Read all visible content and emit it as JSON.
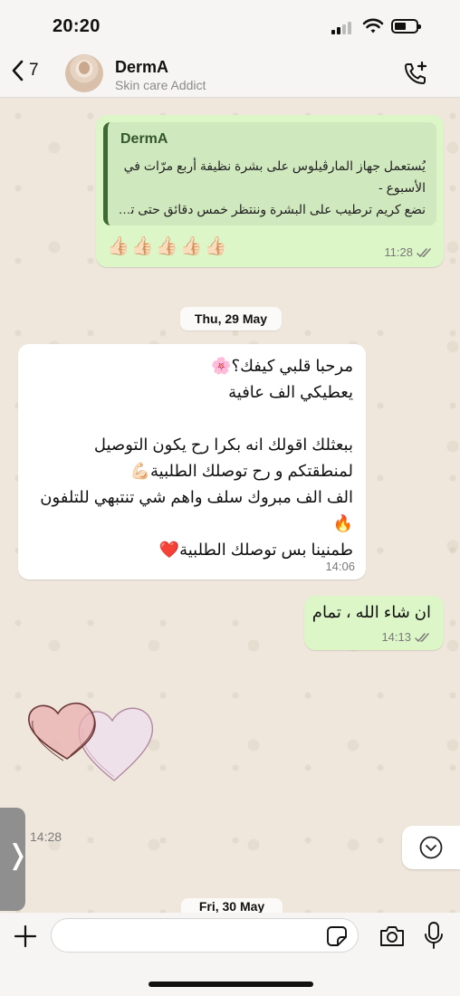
{
  "status_bar": {
    "time": "20:20"
  },
  "header": {
    "back_count": "7",
    "contact_name": "DermA",
    "contact_status": "Skin care Addict"
  },
  "messages": {
    "quoted_reply": {
      "quote_author": "DermA",
      "quote_lines": [
        "يُستعمل جهاز المارڤيلوس على بشرة نظيفة أربع مرّات في",
        "الأسبوع -",
        "نضع كريم ترطيب على البشرة وننتظر خمس دقائق حتى تم..."
      ],
      "reactions": "👍🏻👍🏻👍🏻👍🏻👍🏻",
      "time": "11:28"
    },
    "date_separator": "Thu, 29 May",
    "incoming": {
      "lines": [
        "مرحبا قلبي كيفك؟🌸",
        "يعطيكي الف عافية",
        "",
        "ببعثلك اقولك انه بكرا  رح يكون التوصيل",
        "لمنطقتكم و رح توصلك الطلبية💪🏻",
        "الف الف مبروك سلف واهم شي تنتبهي للتلفون",
        "🔥",
        "طمنينا بس توصلك الطلبية❤️"
      ],
      "time": "14:06"
    },
    "outgoing_short": {
      "text": "ان شاء الله ، تمام",
      "time": "14:13"
    },
    "sticker": {
      "name": "hearts-sticker"
    },
    "sticker_time": "14:28",
    "next_date_separator": "Fri, 30 May"
  },
  "input": {
    "placeholder": "",
    "value": ""
  },
  "colors": {
    "outgoing_bubble": "#dcf6c7",
    "incoming_bubble": "#ffffff",
    "quote_accent": "#3e6b34",
    "read_ticks": "#7a7a7a"
  }
}
